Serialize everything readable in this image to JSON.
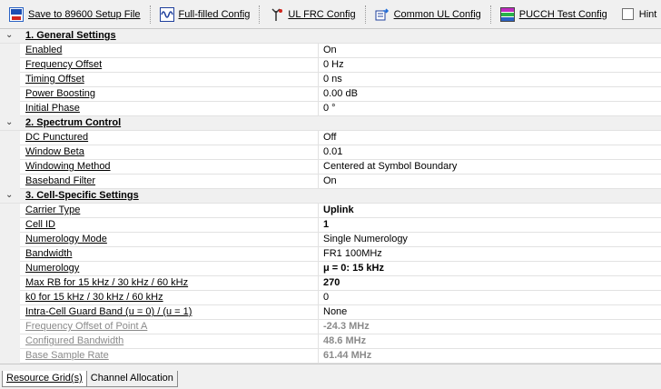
{
  "toolbar": {
    "save": "Save to 89600 Setup File",
    "full": "Full-filled Config",
    "ulfrc": "UL FRC Config",
    "common": "Common UL Config",
    "pucch": "PUCCH Test Config",
    "hint": "Hint",
    "hint_checked": false
  },
  "sections": [
    {
      "title": "1. General Settings",
      "rows": [
        {
          "name": "Enabled",
          "value": "On"
        },
        {
          "name": "Frequency Offset",
          "value": "0 Hz"
        },
        {
          "name": "Timing Offset",
          "value": "0 ns"
        },
        {
          "name": "Power Boosting",
          "value": "0.00 dB"
        },
        {
          "name": "Initial Phase",
          "value": "0 °"
        }
      ]
    },
    {
      "title": "2. Spectrum Control",
      "rows": [
        {
          "name": "DC Punctured",
          "value": "Off"
        },
        {
          "name": "Window Beta",
          "value": "0.01"
        },
        {
          "name": "Windowing Method",
          "value": "Centered at Symbol Boundary"
        },
        {
          "name": "Baseband Filter",
          "value": "On"
        }
      ]
    },
    {
      "title": "3. Cell-Specific Settings",
      "rows": [
        {
          "name": "Carrier Type",
          "value": "Uplink",
          "bold": true
        },
        {
          "name": "Cell ID",
          "value": "1",
          "bold": true
        },
        {
          "name": "Numerology Mode",
          "value": "Single Numerology"
        },
        {
          "name": "Bandwidth",
          "value": "FR1 100MHz"
        },
        {
          "name": "Numerology",
          "value": "μ = 0: 15 kHz",
          "bold": true
        },
        {
          "name": "Max RB for 15 kHz / 30 kHz / 60 kHz",
          "value": "270",
          "bold": true
        },
        {
          "name": "k0 for 15 kHz / 30 kHz / 60 kHz",
          "value": "0"
        },
        {
          "name": "Intra-Cell Guard Band (u = 0) / (u = 1)",
          "value": "None"
        },
        {
          "name": "Frequency Offset of Point A",
          "value": "-24.3 MHz",
          "dim": true
        },
        {
          "name": "Configured Bandwidth",
          "value": "48.6 MHz",
          "dim": true
        },
        {
          "name": "Base Sample Rate",
          "value": "61.44 MHz",
          "dim": true
        }
      ]
    }
  ],
  "tabs": [
    "Resource Grid(s)",
    "Channel Allocation"
  ],
  "icons": {
    "save": "save-setup-icon",
    "full": "signal-config-icon",
    "ulfrc": "antenna-icon",
    "common": "config-arrow-icon",
    "pucch": "grid-colored-icon",
    "expand": "chevron-down-icon"
  }
}
